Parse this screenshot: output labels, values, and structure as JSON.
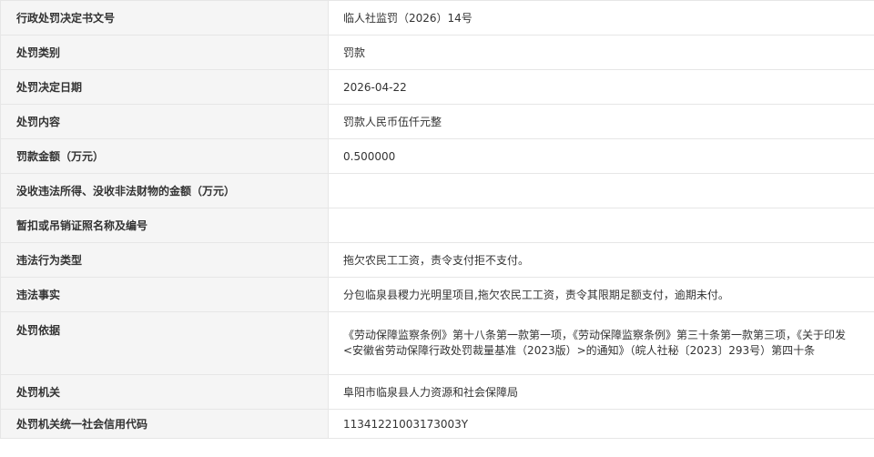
{
  "rows": [
    {
      "label": "行政处罚决定书文号",
      "value": "临人社监罚（2026）14号"
    },
    {
      "label": "处罚类别",
      "value": "罚款"
    },
    {
      "label": "处罚决定日期",
      "value": "2026-04-22"
    },
    {
      "label": "处罚内容",
      "value": "罚款人民币伍仟元整"
    },
    {
      "label": "罚款金额（万元）",
      "value": "0.500000"
    },
    {
      "label": "没收违法所得、没收非法财物的金额（万元）",
      "value": ""
    },
    {
      "label": "暂扣或吊销证照名称及编号",
      "value": ""
    },
    {
      "label": "违法行为类型",
      "value": "拖欠农民工工资，责令支付拒不支付。"
    },
    {
      "label": "违法事实",
      "value": "分包临泉县稷力光明里项目,拖欠农民工工资，责令其限期足额支付，逾期未付。"
    },
    {
      "label": "处罚依据",
      "value": "《劳动保障监察条例》第十八条第一款第一项，《劳动保障监察条例》第三十条第一款第三项，《关于印发<安徽省劳动保障行政处罚裁量基准（2023版）>的通知》（皖人社秘〔2023〕293号）第四十条"
    },
    {
      "label": "处罚机关",
      "value": "阜阳市临泉县人力资源和社会保障局"
    },
    {
      "label": "处罚机关统一社会信用代码",
      "value": "11341221003173003Y"
    }
  ]
}
